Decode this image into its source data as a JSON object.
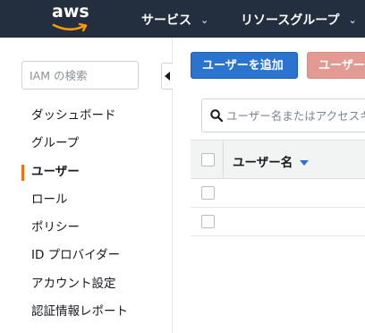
{
  "header": {
    "logo_text": "aws",
    "menu": [
      {
        "label": "サービス",
        "caret": "⌄"
      },
      {
        "label": "リソースグループ",
        "caret": "⌄"
      }
    ]
  },
  "sidebar": {
    "search_placeholder": "IAM の検索",
    "items": [
      {
        "label": "ダッシュボード",
        "active": false
      },
      {
        "label": "グループ",
        "active": false
      },
      {
        "label": "ユーザー",
        "active": true
      },
      {
        "label": "ロール",
        "active": false
      },
      {
        "label": "ポリシー",
        "active": false
      },
      {
        "label": "ID プロバイダー",
        "active": false
      },
      {
        "label": "アカウント設定",
        "active": false
      },
      {
        "label": "認証情報レポート",
        "active": false
      }
    ]
  },
  "main": {
    "add_user_button": "ユーザーを追加",
    "delete_user_button": "ユーザーを削除",
    "table": {
      "search_placeholder": "ユーザー名またはアクセスキーでユーザーを検索",
      "column_username": "ユーザー名",
      "rows": [
        {},
        {}
      ]
    }
  },
  "colors": {
    "topbar": "#232f3e",
    "primary_button": "#2a73cf",
    "danger_button_disabled": "#e39a92",
    "active_indicator": "#ec7211"
  },
  "icons": [
    "aws-logo-icon",
    "chevron-down-icon",
    "collapse-left-icon",
    "search-icon",
    "sort-down-icon"
  ]
}
